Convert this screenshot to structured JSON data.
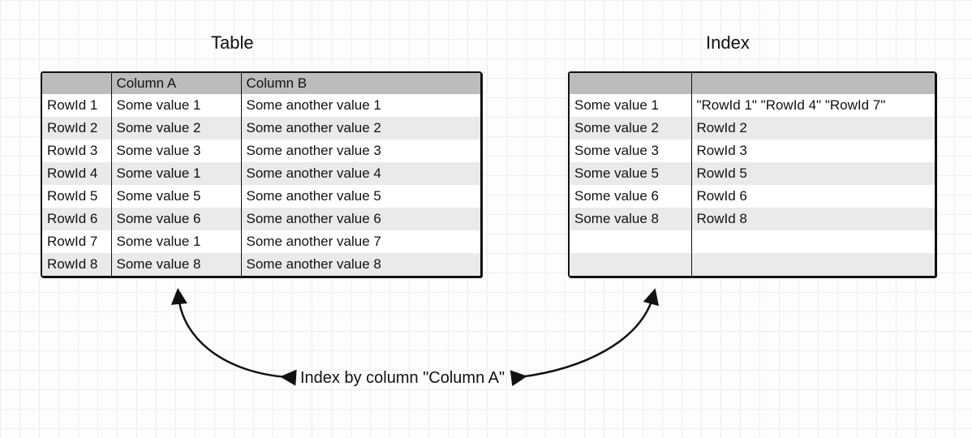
{
  "titles": {
    "left": "Table",
    "right": "Index"
  },
  "left_table": {
    "headers": [
      "",
      "Column A",
      "Column B"
    ],
    "rows": [
      {
        "id": "RowId 1",
        "a": "Some value 1",
        "b": "Some another value 1"
      },
      {
        "id": "RowId 2",
        "a": "Some value 2",
        "b": "Some another value 2"
      },
      {
        "id": "RowId 3",
        "a": "Some value 3",
        "b": "Some another value 3"
      },
      {
        "id": "RowId 4",
        "a": "Some value 1",
        "b": "Some another value 4"
      },
      {
        "id": "RowId 5",
        "a": "Some value 5",
        "b": "Some another value 5"
      },
      {
        "id": "RowId 6",
        "a": "Some value 6",
        "b": "Some another value 6"
      },
      {
        "id": "RowId 7",
        "a": "Some value 1",
        "b": "Some another value 7"
      },
      {
        "id": "RowId 8",
        "a": "Some value 8",
        "b": "Some another value 8"
      }
    ]
  },
  "right_table": {
    "rows": [
      {
        "key": "Some value 1",
        "val": "\"RowId 1\" \"RowId 4\" \"RowId 7\""
      },
      {
        "key": "Some value 2",
        "val": "RowId 2"
      },
      {
        "key": "Some value 3",
        "val": "RowId 3"
      },
      {
        "key": "Some value 5",
        "val": "RowId 5"
      },
      {
        "key": "Some value 6",
        "val": "RowId 6"
      },
      {
        "key": "Some value 8",
        "val": "RowId 8"
      },
      {
        "key": "",
        "val": ""
      },
      {
        "key": "",
        "val": ""
      }
    ]
  },
  "caption": "Index by column \"Column A\""
}
